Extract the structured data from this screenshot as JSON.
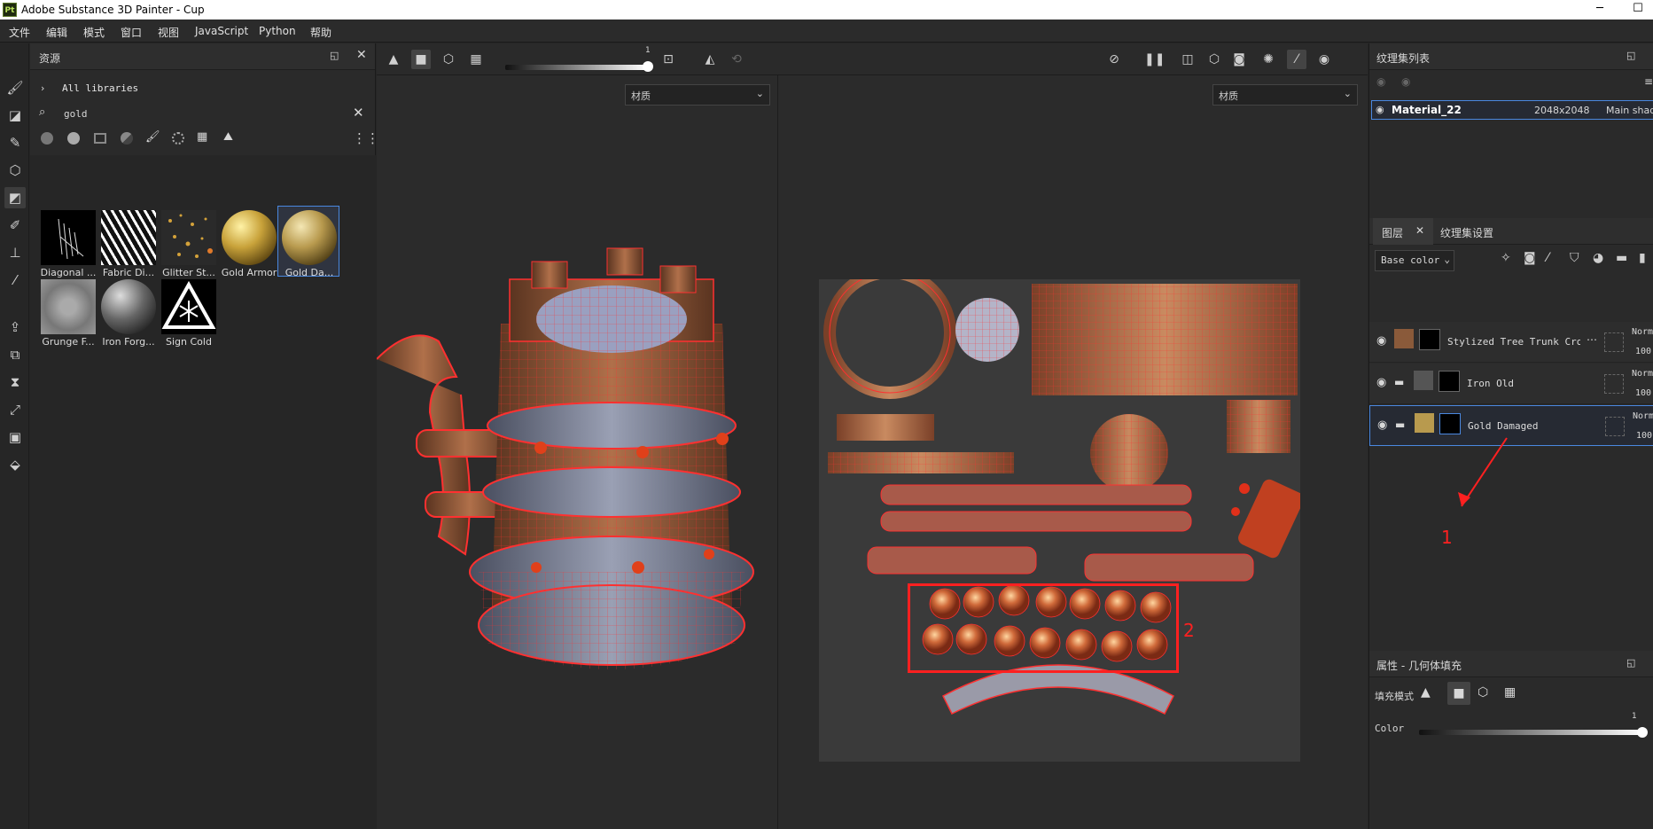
{
  "window": {
    "title": "Adobe Substance 3D Painter - Cup",
    "logo": "Pt",
    "minimize": "─",
    "maximize": "☐"
  },
  "menu": [
    "文件",
    "编辑",
    "模式",
    "窗口",
    "视图",
    "JavaScript",
    "Python",
    "帮助"
  ],
  "assets": {
    "title": "资源",
    "breadcrumb": "All libraries",
    "search_value": "gold",
    "items": [
      {
        "label": "Diagonal ..."
      },
      {
        "label": "Fabric Di..."
      },
      {
        "label": "Glitter St..."
      },
      {
        "label": "Gold Armor"
      },
      {
        "label": "Gold Da..."
      },
      {
        "label": "Grunge F..."
      },
      {
        "label": "Iron Forg..."
      },
      {
        "label": "Sign Cold"
      }
    ]
  },
  "viewport": {
    "slider_value": "1",
    "left_dropdown": "材质",
    "right_dropdown": "材质",
    "annotation_1": "1",
    "annotation_2": "2"
  },
  "texture_set_list": {
    "title": "纹理集列表",
    "row_name": "Material_22",
    "row_size": "2048x2048",
    "row_shader": "Main shader"
  },
  "layers": {
    "tab_layers": "图层",
    "tab_settings": "纹理集设置",
    "channel": "Base color",
    "rows": [
      {
        "name": "Stylized Tree Trunk Cross",
        "blend": "Norm",
        "opacity": "100"
      },
      {
        "name": "Iron Old",
        "blend": "Norm",
        "opacity": "100"
      },
      {
        "name": "Gold Damaged",
        "blend": "Norm",
        "opacity": "100"
      }
    ]
  },
  "properties": {
    "title": "属性 - 几何体填充",
    "fill_mode_label": "填充模式",
    "color_label": "Color",
    "color_value": "1"
  },
  "colors": {
    "accent": "#2d6fd6",
    "annotation": "#ff2020"
  }
}
